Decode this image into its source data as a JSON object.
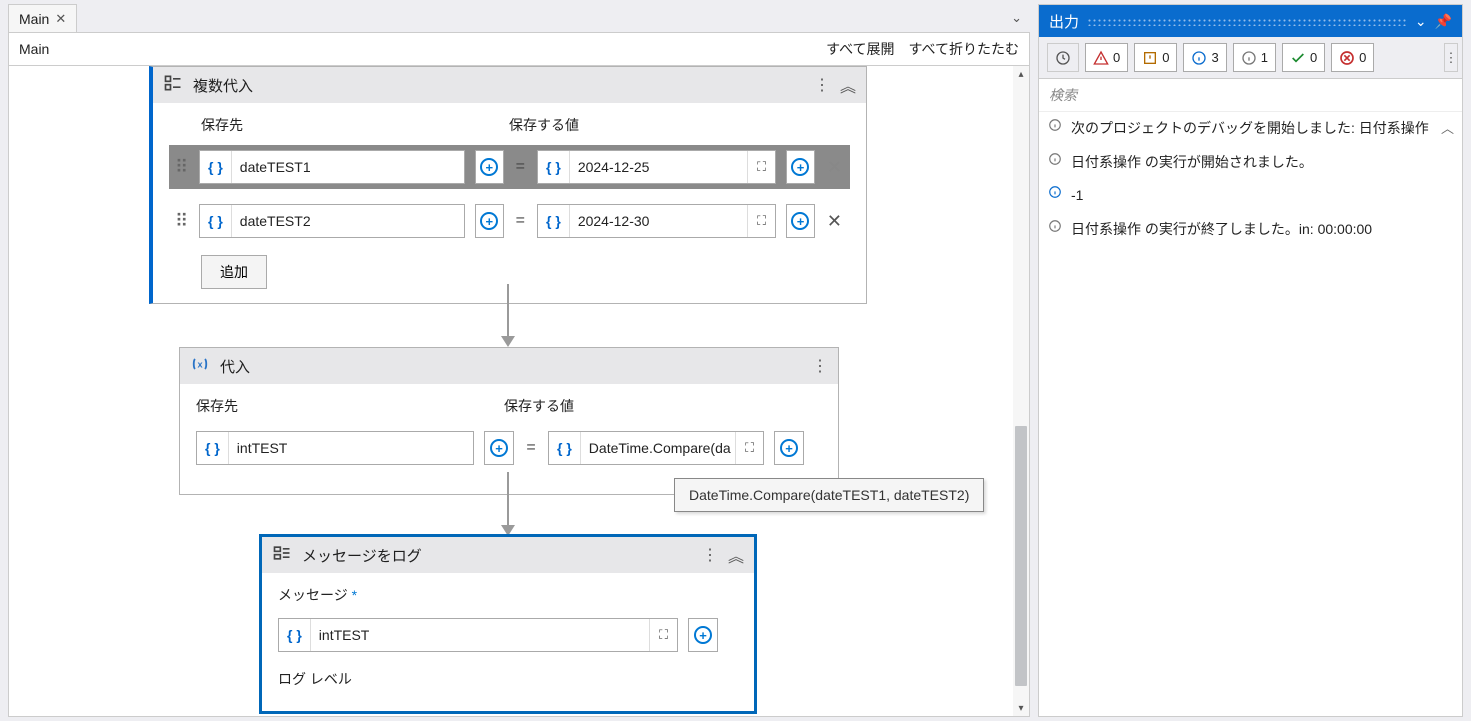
{
  "tab": {
    "name": "Main"
  },
  "breadcrumb": "Main",
  "actions": {
    "expand_all": "すべて展開",
    "collapse_all": "すべて折りたたむ"
  },
  "multi_assign": {
    "title": "複数代入",
    "col1": "保存先",
    "col2": "保存する値",
    "rows": [
      {
        "var": "dateTEST1",
        "val": "2024-12-25"
      },
      {
        "var": "dateTEST2",
        "val": "2024-12-30"
      }
    ],
    "add": "追加"
  },
  "assign": {
    "title": "代入",
    "col1": "保存先",
    "col2": "保存する値",
    "var": "intTEST",
    "val": "DateTime.Compare(da"
  },
  "tooltip": "DateTime.Compare(dateTEST1, dateTEST2)",
  "log": {
    "title": "メッセージをログ",
    "msg_label": "メッセージ",
    "msg_value": "intTEST",
    "level_label": "ログ レベル"
  },
  "output": {
    "title": "出力",
    "counts": {
      "error": "0",
      "warn": "0",
      "info": "3",
      "trace": "1",
      "ok": "0",
      "fail": "0"
    },
    "search": "検索",
    "items": [
      "次のプロジェクトのデバッグを開始しました: 日付系操作",
      "日付系操作 の実行が開始されました。",
      "-1",
      "日付系操作 の実行が終了しました。in: 00:00:00"
    ]
  }
}
